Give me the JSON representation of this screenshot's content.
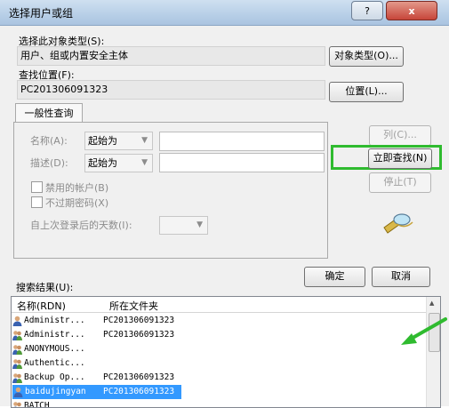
{
  "window": {
    "title": "选择用户或组",
    "help_label": "?",
    "close_label": "x"
  },
  "object_type": {
    "label": "选择此对象类型(S):",
    "value": "用户、组或内置安全主体",
    "button": "对象类型(O)..."
  },
  "location": {
    "label": "查找位置(F):",
    "value": "PC201306091323",
    "button": "位置(L)..."
  },
  "query": {
    "tab_label": "一般性查询",
    "name_label": "名称(A):",
    "name_mode": "起始为",
    "desc_label": "描述(D):",
    "desc_mode": "起始为",
    "disabled_accounts": "禁用的帐户(B)",
    "no_expire_password": "不过期密码(X)",
    "days_since_logon": "自上次登录后的天数(I):",
    "columns_button": "列(C)...",
    "find_now_button": "立即查找(N)",
    "stop_button": "停止(T)"
  },
  "actions": {
    "ok": "确定",
    "cancel": "取消"
  },
  "results": {
    "label": "搜索结果(U):",
    "col_name": "名称(RDN)",
    "col_folder": "所在文件夹",
    "rows": [
      {
        "name": "Administr...",
        "folder": "PC201306091323",
        "icon": "user-icon"
      },
      {
        "name": "Administr...",
        "folder": "PC201306091323",
        "icon": "group-icon"
      },
      {
        "name": "ANONYMOUS...",
        "folder": "",
        "icon": "group-icon"
      },
      {
        "name": "Authentic...",
        "folder": "",
        "icon": "group-icon"
      },
      {
        "name": "Backup Op...",
        "folder": "PC201306091323",
        "icon": "group-icon"
      },
      {
        "name": "baidujingyan",
        "folder": "PC201306091323",
        "icon": "user-icon",
        "selected": true
      },
      {
        "name": "BATCH",
        "folder": "",
        "icon": "group-icon"
      }
    ]
  },
  "colors": {
    "highlight_box": "#2fbb2f",
    "annotation_arrow": "#2fbb2f",
    "selection": "#3399ff"
  }
}
